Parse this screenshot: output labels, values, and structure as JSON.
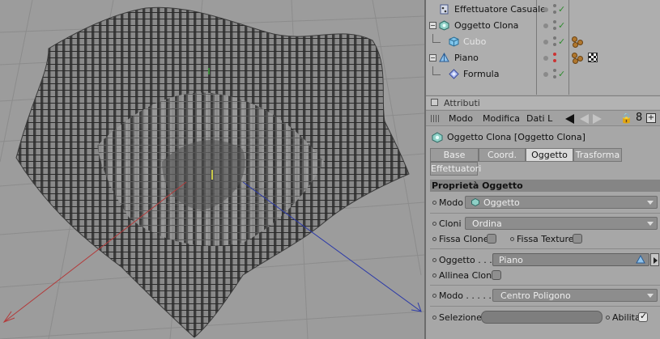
{
  "objects": [
    {
      "name": "Effettuatore Casuale",
      "icon": "random-effector-icon",
      "enabled": true,
      "dimmed": false
    },
    {
      "name": "Oggetto Clona",
      "icon": "cloner-icon",
      "enabled": true,
      "dimmed": false
    },
    {
      "name": "Cubo",
      "icon": "cube-icon",
      "enabled": true,
      "dimmed": true,
      "tags": [
        "material-tag-icon"
      ]
    },
    {
      "name": "Piano",
      "icon": "plane-icon",
      "enabled": false,
      "dimmed": false,
      "tags": [
        "material-tag-icon",
        "texture-tag-icon"
      ]
    },
    {
      "name": "Formula",
      "icon": "formula-deformer-icon",
      "enabled": true,
      "dimmed": false
    }
  ],
  "attributes": {
    "title": "Attributi",
    "menu": [
      "Modo",
      "Modifica",
      "Dati L"
    ],
    "object_label": "Oggetto Clona [Oggetto Clona]",
    "tabs": {
      "base": "Base",
      "coord": "Coord.",
      "oggetto": "Oggetto",
      "trasforma": "Trasforma",
      "effettuatori": "Effettuatori"
    },
    "active_tab": "oggetto",
    "section": "Proprietà Oggetto",
    "modo_label": "Modo",
    "modo_value": "Oggetto",
    "cloni_label": "Cloni",
    "cloni_value": "Ordina",
    "fissa_clone_label": "Fissa Clone",
    "fissa_clone": false,
    "fissa_texture_label": "Fissa Texture",
    "fissa_texture": false,
    "oggetto_label": "Oggetto . . .",
    "oggetto_value": "Piano",
    "allinea_clona_label": "Allinea Clona",
    "allinea_clona": false,
    "modo2_label": "Modo . . . . .",
    "modo2_value": "Centro Poligono",
    "selezione_label": "Selezione",
    "selezione_value": "",
    "abilita_label": "Abilita",
    "abilita": true
  },
  "colors": {
    "viewport_bg": "#9c9c9c",
    "axis_x": "#b33a3a",
    "axis_z": "#2c3aa8",
    "enabled_check": "#2e8b2e",
    "disabled_dot": "#cc3333"
  }
}
